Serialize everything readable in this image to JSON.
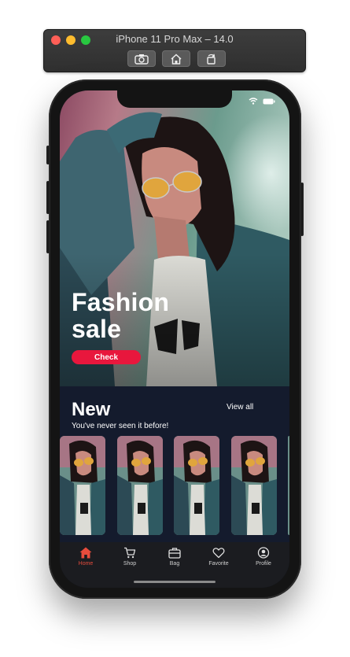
{
  "simulator": {
    "title": "iPhone 11 Pro Max – 14.0",
    "buttons": [
      "screenshot-icon",
      "home-icon",
      "rotate-icon"
    ]
  },
  "status_bar": {
    "time": "",
    "icons": [
      "wifi-icon",
      "battery-icon"
    ]
  },
  "hero": {
    "title": "Fashion\nsale",
    "button_label": "Check"
  },
  "new_section": {
    "title": "New",
    "subtitle": "You've never seen it before!",
    "view_all_label": "View all",
    "thumbnail_count": 4
  },
  "tab_bar": {
    "active": "Home",
    "accent_color": "#e74c3c",
    "items": [
      {
        "label": "Home",
        "icon": "home-icon"
      },
      {
        "label": "Shop",
        "icon": "cart-icon"
      },
      {
        "label": "Bag",
        "icon": "bag-icon"
      },
      {
        "label": "Favorite",
        "icon": "heart-icon"
      },
      {
        "label": "Profile",
        "icon": "profile-icon"
      }
    ]
  },
  "colors": {
    "sale_red": "#e8173d",
    "background_dark": "#141b2d"
  }
}
